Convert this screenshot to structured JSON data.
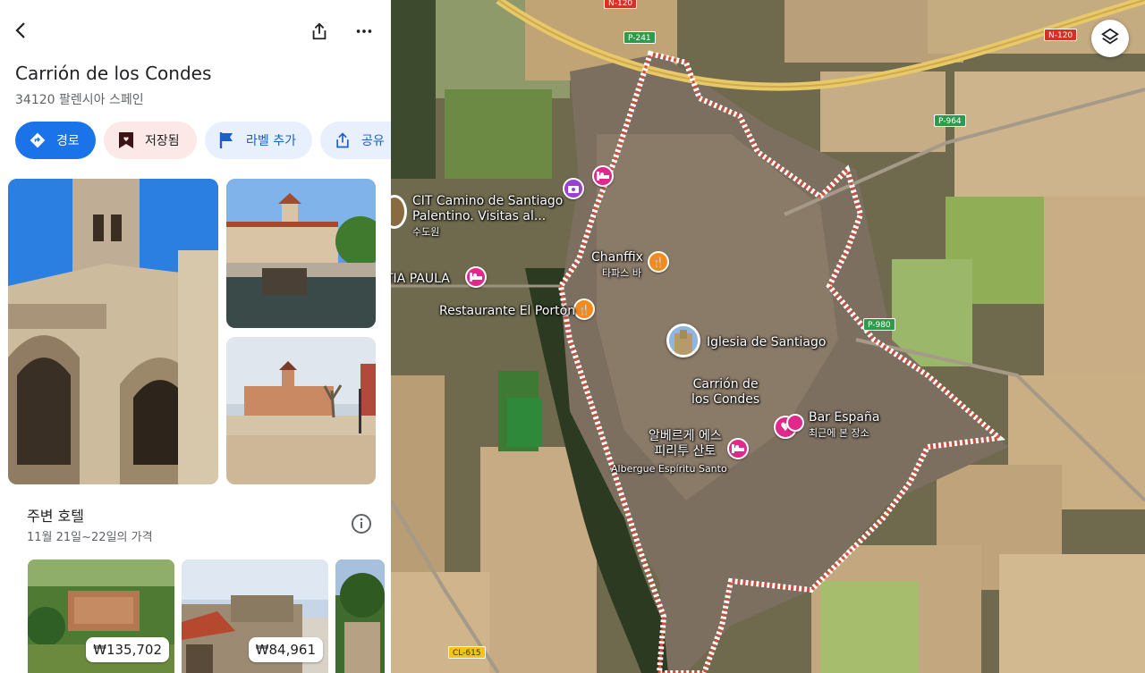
{
  "place": {
    "name": "Carrión de los Condes",
    "address": "34120 팔렌시아 스페인"
  },
  "actions": {
    "route": "경로",
    "saved": "저장됨",
    "add_label": "라벨 추가",
    "share": "공유"
  },
  "hotels": {
    "title": "주변 호텔",
    "dates": "11월 21일~22일의 가격",
    "items": [
      {
        "price": "₩135,702"
      },
      {
        "price": "₩84,961"
      }
    ]
  },
  "map": {
    "labels": {
      "cit_line1": "CIT Camino de Santiago",
      "cit_line2": "Palentino. Visitas al...",
      "cit_sub": "수도원",
      "tia_paula": "TIA PAULA",
      "chanffix": "Chanffix",
      "chanffix_sub": "타파스 바",
      "restaurante": "Restaurante El Portón",
      "iglesia": "Iglesia de Santiago",
      "town_line1": "Carrión de",
      "town_line2": "los Condes",
      "bar_espana": "Bar España",
      "bar_espana_sub": "최근에 본 장소",
      "albergue_ko_line1": "알베르게 에스",
      "albergue_ko_line2": "피리투 산토",
      "albergue": "Albergue Espíritu Santo"
    },
    "roads": {
      "n120_top": "N-120",
      "n120_right": "N-120",
      "p241": "P-241",
      "p964": "P-964",
      "p980": "P-980",
      "cl615": "CL-615"
    }
  },
  "icons": {
    "back": "back-arrow-icon",
    "share": "share-icon",
    "more": "more-vert-icon",
    "layers": "layers-icon",
    "info": "info-icon"
  },
  "colors": {
    "primary": "#1a73e8",
    "saved_bg": "#fce8e6",
    "chip_bg": "#e8f0fe",
    "pin_pink": "#e0298a",
    "pin_orange": "#f28b1c"
  }
}
